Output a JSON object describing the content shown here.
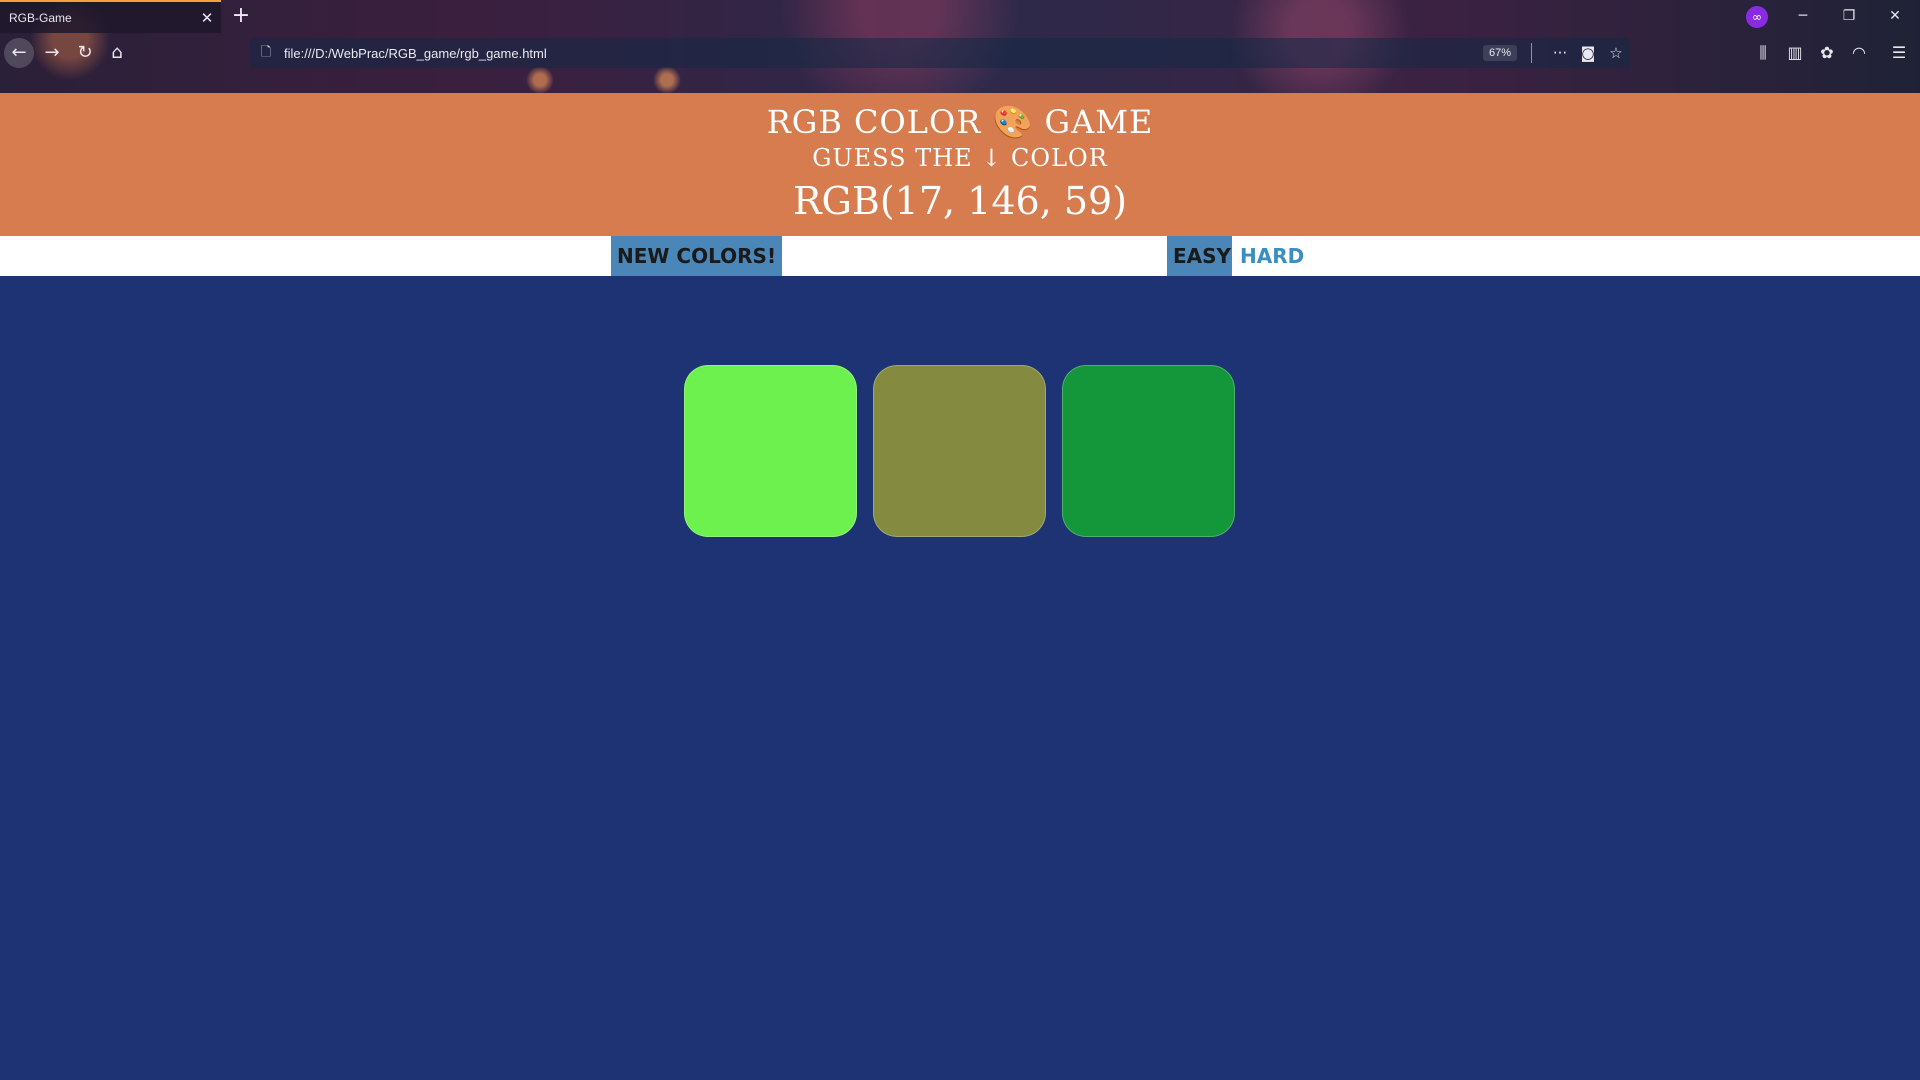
{
  "browser": {
    "tab_title": "RGB-Game",
    "tab_close": "✕",
    "new_tab": "+",
    "url": "file:///D:/WebPrac/RGB_game/rgb_game.html",
    "zoom": "67%"
  },
  "game": {
    "title": "RGB COLOR 🎨 GAME",
    "subtitle": "GUESS THE ↓ COLOR",
    "target": "RGB(17, 146, 59)",
    "header_color": "#d67c4e",
    "background_color": "#1e3373",
    "new_colors_label": "NEW COLORS!",
    "easy_label": "EASY",
    "hard_label": "HARD",
    "squares": [
      {
        "color": "#6cf14e"
      },
      {
        "color": "#848b40"
      },
      {
        "color": "#14963b"
      }
    ]
  },
  "icons": {
    "back": "back-arrow-icon",
    "forward": "forward-arrow-icon",
    "reload": "reload-icon",
    "home": "home-icon",
    "page": "page-icon",
    "more": "more-icon",
    "pocket": "pocket-icon",
    "bookmark": "star-icon",
    "library": "library-icon",
    "sidebar": "sidebar-icon",
    "menu": "hamburger-menu-icon"
  }
}
